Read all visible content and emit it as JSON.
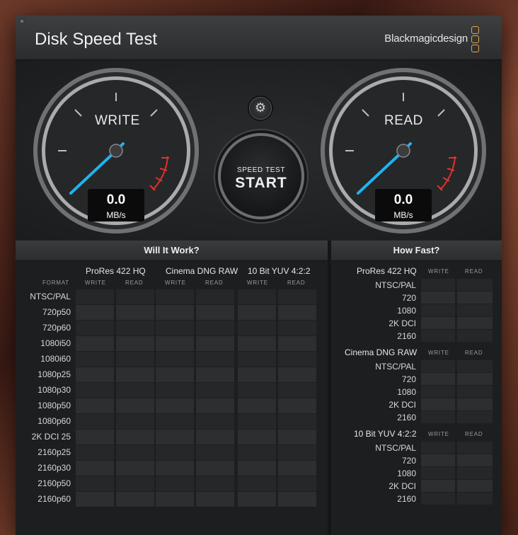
{
  "window": {
    "title": "Disk Speed Test",
    "brand": "Blackmagicdesign",
    "close_glyph": "×"
  },
  "gauges": {
    "write": {
      "label": "WRITE",
      "value": "0.0",
      "unit": "MB/s"
    },
    "read": {
      "label": "READ",
      "value": "0.0",
      "unit": "MB/s"
    }
  },
  "start_button": {
    "line1": "SPEED TEST",
    "line2": "START"
  },
  "settings_icon": "gear-icon",
  "will_it_work": {
    "heading": "Will It Work?",
    "format_label": "FORMAT",
    "codecs": [
      "ProRes 422 HQ",
      "Cinema DNG RAW",
      "10 Bit YUV 4:2:2"
    ],
    "sub_labels": [
      "WRITE",
      "READ"
    ],
    "formats": [
      "NTSC/PAL",
      "720p50",
      "720p60",
      "1080i50",
      "1080i60",
      "1080p25",
      "1080p30",
      "1080p50",
      "1080p60",
      "2K DCI 25",
      "2160p25",
      "2160p30",
      "2160p50",
      "2160p60"
    ]
  },
  "how_fast": {
    "heading": "How Fast?",
    "sub_labels": [
      "WRITE",
      "READ"
    ],
    "groups": [
      {
        "name": "ProRes 422 HQ",
        "rows": [
          "NTSC/PAL",
          "720",
          "1080",
          "2K DCI",
          "2160"
        ]
      },
      {
        "name": "Cinema DNG RAW",
        "rows": [
          "NTSC/PAL",
          "720",
          "1080",
          "2K DCI",
          "2160"
        ]
      },
      {
        "name": "10 Bit YUV 4:2:2",
        "rows": [
          "NTSC/PAL",
          "720",
          "1080",
          "2K DCI",
          "2160"
        ]
      }
    ]
  },
  "colors": {
    "needle": "#1eb4f0",
    "redzone": "#e0322a",
    "accent": "#e8a24a"
  }
}
